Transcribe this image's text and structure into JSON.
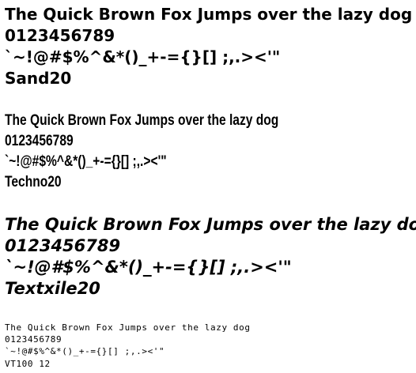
{
  "samples": [
    {
      "pangram": "The Quick Brown Fox Jumps over the lazy dog",
      "digits": "0123456789",
      "symbols": "`~!@#$%^&*()_+-={}[] ;,.><'\"",
      "font_name": "Sand20"
    },
    {
      "pangram": "The Quick Brown Fox Jumps over the lazy dog",
      "digits": "0123456789",
      "symbols": "`~!@#$%^&*()_+-={}[] ;,.><'\"",
      "font_name": "Techno20"
    },
    {
      "pangram": "The Quick Brown Fox Jumps over the lazy dog",
      "digits": "0123456789",
      "symbols": "`~!@#$%^&*()_+-={}[] ;,.><'\"",
      "font_name": "Textxile20"
    },
    {
      "pangram": "The Quick Brown Fox Jumps over the lazy dog",
      "digits": "0123456789",
      "symbols": "`~!@#$%^&*()_+-={}[] ;,.><'\"",
      "font_name": "VT100 12"
    }
  ]
}
